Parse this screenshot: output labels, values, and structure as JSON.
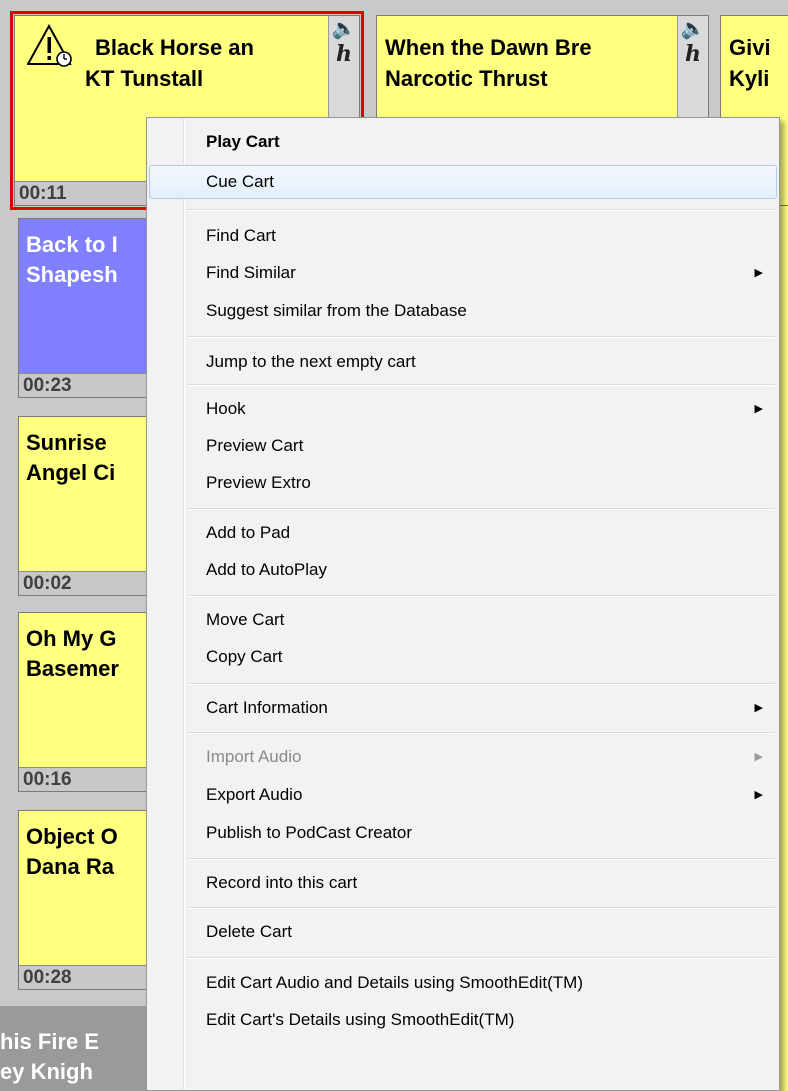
{
  "carts": [
    {
      "line1": "Black Horse an",
      "line2": "KT Tunstall",
      "time": "00:11",
      "color": "#ffff80",
      "selected": true,
      "icon": "warning-clock-icon"
    },
    {
      "line1": "When the Dawn Bre",
      "line2": "Narcotic Thrust",
      "time": "",
      "color": "#ffff80"
    },
    {
      "line1": "Givi",
      "line2": "Kyli",
      "time": "",
      "color": "#ffff80"
    },
    {
      "line1": "Back to I",
      "line2": "Shapesh",
      "time": "00:23",
      "color": "#8080ff"
    },
    {
      "line1": "Sunrise",
      "line2": "Angel Ci",
      "time": "00:02",
      "color": "#ffff80"
    },
    {
      "line1": "Oh My G",
      "line2": "Basemer",
      "time": "00:16",
      "color": "#ffff80"
    },
    {
      "line1": "Object O",
      "line2": "Dana Ra",
      "time": "00:28",
      "color": "#ffff80"
    },
    {
      "line1": "his Fire E",
      "line2": "ey Knigh",
      "time": "",
      "color": "#9a9a9a"
    }
  ],
  "sidebox": {
    "speaker_icon": "speaker-icon",
    "letter": "h"
  },
  "menu": {
    "items": [
      {
        "label": "Play Cart",
        "bold": true
      },
      {
        "label": "Cue Cart",
        "highlighted": true
      },
      {
        "label": "Find Cart"
      },
      {
        "label": "Find Similar",
        "submenu": true
      },
      {
        "label": "Suggest similar from the Database"
      },
      {
        "label": "Jump to the next empty cart"
      },
      {
        "label": "Hook",
        "submenu": true
      },
      {
        "label": "Preview Cart"
      },
      {
        "label": "Preview Extro"
      },
      {
        "label": "Add to Pad"
      },
      {
        "label": "Add to AutoPlay"
      },
      {
        "label": "Move Cart"
      },
      {
        "label": "Copy Cart"
      },
      {
        "label": "Cart Information",
        "submenu": true
      },
      {
        "label": "Import Audio",
        "submenu": true,
        "disabled": true
      },
      {
        "label": "Export Audio",
        "submenu": true
      },
      {
        "label": "Publish to PodCast Creator"
      },
      {
        "label": "Record into this cart"
      },
      {
        "label": "Delete Cart"
      },
      {
        "label": "Edit Cart Audio and Details using SmoothEdit(TM)"
      },
      {
        "label": "Edit Cart's Details using SmoothEdit(TM)"
      }
    ],
    "submenu_arrow": "▶"
  }
}
